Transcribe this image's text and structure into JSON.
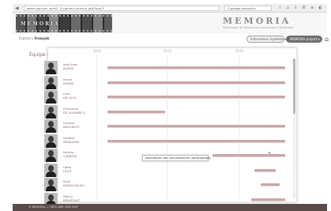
{
  "browser": {
    "nav_label": "◀",
    "url": "memoriaprose.safe2.fr/gerant/prosib.php?arg=3",
    "search": "Q google traduction",
    "toolbar_icons": "☆ ⌂ ⇩ ⚙ ≡ ◐"
  },
  "header": {
    "logo_text": "MEMORIA",
    "title": "MEMORIA",
    "subtitle": "Mobilisation de Ressources communes à l'Université"
  },
  "subbar": {
    "language_label": "Español |",
    "language_current": "Français",
    "secondary_button": "Information Système ▾",
    "primary_button": "MEMORIA project ▾",
    "home_icon": "home-icon"
  },
  "panel": {
    "team_label": "Équipe :",
    "years": [
      "2010",
      "2013",
      "2016"
    ],
    "tooltip": "exploitation des connaissances (participation)"
  },
  "members": [
    {
      "first": "Jean-Yves",
      "last": "BLAISE",
      "bar": [
        0.05,
        0.98
      ]
    },
    {
      "first": "Iwona",
      "last": "DUDEK",
      "bar": [
        0.05,
        0.98
      ]
    },
    {
      "first": "Livio",
      "last": "DE LUCA",
      "bar": [
        0.05,
        0.98
      ]
    },
    {
      "first": "Francesca",
      "last": "DE DOMENICO",
      "bar": [
        0.05,
        0.35
      ]
    },
    {
      "first": "Laurent",
      "last": "BERGEROT",
      "bar": [
        0.05,
        0.98
      ]
    },
    {
      "first": "Violette",
      "last": "RENAUDIN",
      "bar": [
        0.05,
        0.98
      ]
    },
    {
      "first": "Nicolas",
      "last": "CARBONI",
      "bar": [
        0.6,
        0.98
      ]
    },
    {
      "first": "Hafid",
      "last": "HOUT",
      "bar": [
        0.82,
        0.93
      ]
    },
    {
      "first": "Eloïs",
      "last": "KARAOUALISU",
      "bar": [
        0.85,
        0.95
      ]
    },
    {
      "first": "Pascal",
      "last": "BÉNISTANT",
      "bar": [
        0.8,
        0.98
      ]
    }
  ],
  "footer": {
    "text": "© MEMORIA — CNRS UMR 3495 MAP"
  },
  "colors": {
    "bar": "#caa6a6",
    "name": "#8b6666",
    "footer": "#5a4a4a"
  }
}
